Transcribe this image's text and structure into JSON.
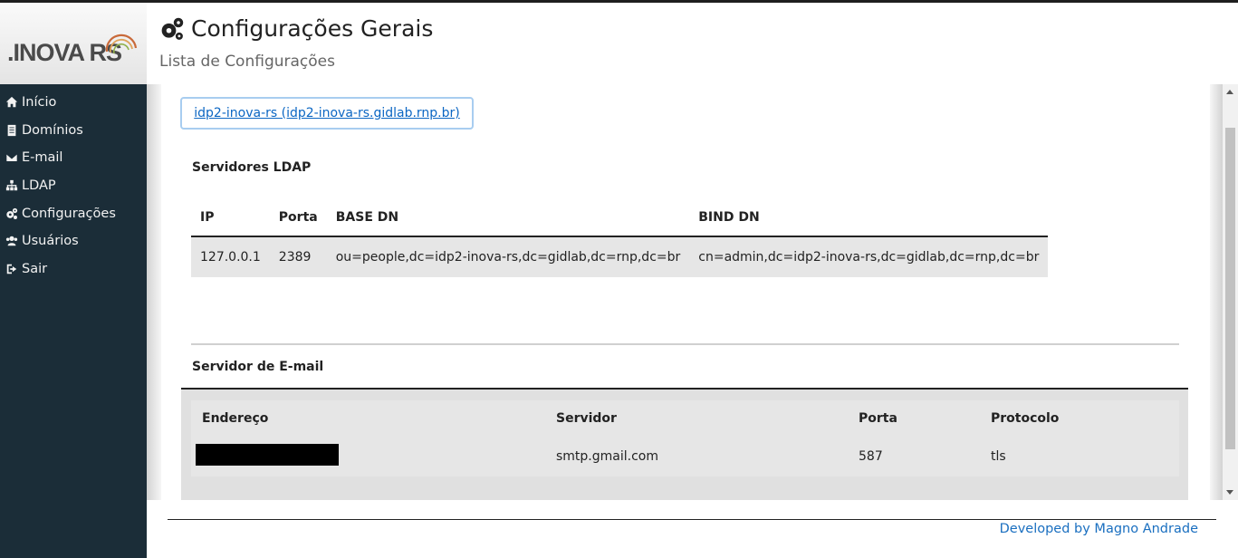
{
  "brand": {
    "logo_text": ".INOVA RS"
  },
  "sidebar": {
    "items": [
      {
        "label": "Início",
        "icon": "home-icon"
      },
      {
        "label": "Domínios",
        "icon": "book-icon"
      },
      {
        "label": "E-mail",
        "icon": "envelope-icon"
      },
      {
        "label": "LDAP",
        "icon": "sitemap-icon"
      },
      {
        "label": "Configurações",
        "icon": "gears-icon"
      },
      {
        "label": "Usuários",
        "icon": "users-icon"
      },
      {
        "label": "Sair",
        "icon": "sign-out-icon"
      }
    ]
  },
  "header": {
    "title": "Configurações Gerais",
    "subtitle": "Lista de Configurações",
    "title_icon": "gears-icon"
  },
  "domain_tab": {
    "label": "idp2-inova-rs (idp2-inova-rs.gidlab.rnp.br)"
  },
  "ldap": {
    "section_title": "Servidores LDAP",
    "columns": [
      "IP",
      "Porta",
      "BASE DN",
      "BIND DN"
    ],
    "rows": [
      [
        "127.0.0.1",
        "2389",
        "ou=people,dc=idp2-inova-rs,dc=gidlab,dc=rnp,dc=br",
        "cn=admin,dc=idp2-inova-rs,dc=gidlab,dc=rnp,dc=br"
      ]
    ]
  },
  "email": {
    "section_title": "Servidor de E-mail",
    "columns": [
      "Endereço",
      "Servidor",
      "Porta",
      "Protocolo"
    ],
    "rows": [
      {
        "address_redacted": true,
        "server": "smtp.gmail.com",
        "port": "587",
        "protocol": "tls"
      }
    ]
  },
  "footer": {
    "credit": "Developed by Magno Andrade"
  },
  "colors": {
    "sidebar_bg": "#1b2d38",
    "link": "#0b66c3",
    "tab_border": "#a8cdf0"
  }
}
